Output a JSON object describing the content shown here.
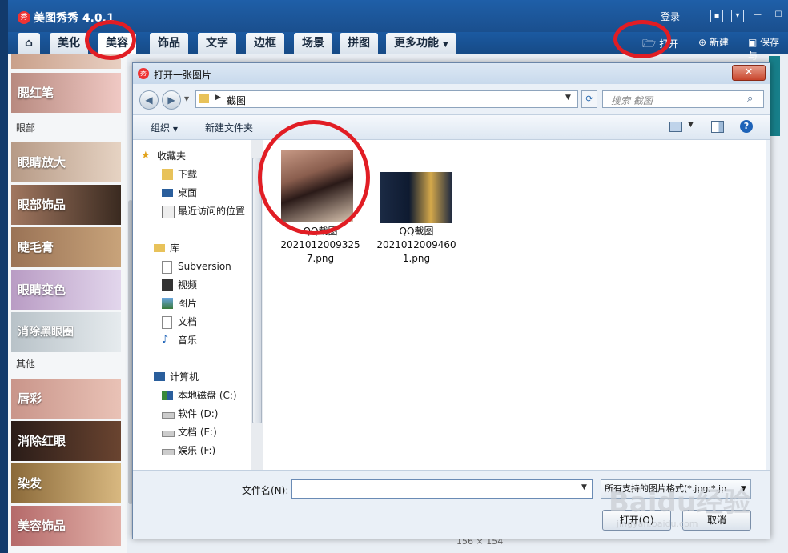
{
  "app": {
    "logo_text": "秀",
    "title": "美图秀秀 4.0.1",
    "login": "登录",
    "tabs": [
      "美化",
      "美容",
      "饰品",
      "文字",
      "边框",
      "场景",
      "拼图",
      "更多功能"
    ],
    "active_tab": "美容",
    "toolbar": {
      "open": "打开",
      "new": "新建",
      "save": "保存与"
    }
  },
  "left_panel": {
    "sections": {
      "eye": "眼部",
      "other": "其他"
    },
    "items": [
      "腮红笔",
      "眼睛放大",
      "眼部饰品",
      "睫毛膏",
      "眼睛变色",
      "消除黑眼圈",
      "唇彩",
      "消除红眼",
      "染发",
      "美容饰品"
    ]
  },
  "dialog": {
    "title": "打开一张图片",
    "path": "截图",
    "search_placeholder": "搜索 截图",
    "commands": {
      "organize": "组织",
      "new_folder": "新建文件夹"
    },
    "nav": {
      "favorites": "收藏夹",
      "favorites_items": [
        "下载",
        "桌面",
        "最近访问的位置"
      ],
      "libraries": "库",
      "libraries_items": [
        "Subversion",
        "视频",
        "图片",
        "文档",
        "音乐"
      ],
      "computer": "计算机",
      "drives": [
        "本地磁盘 (C:)",
        "软件 (D:)",
        "文档 (E:)",
        "娱乐 (F:)"
      ]
    },
    "files": [
      {
        "name_lines": [
          "QQ截图",
          "2021012009325",
          "7.png"
        ]
      },
      {
        "name_lines": [
          "QQ截图",
          "2021012009460",
          "1.png"
        ]
      }
    ],
    "filename_label": "文件名(N):",
    "filename_value": "",
    "filetype": "所有支持的图片格式(*.jpg;*.jp",
    "open_button": "打开(O)",
    "cancel_button": "取消"
  },
  "status": {
    "text": "156 × 154"
  },
  "watermark": {
    "main": "Baidu经验",
    "sub": "jingyan.baidu.com"
  },
  "colors": {
    "accent": "#1a4f8e",
    "annotation": "#e11d24"
  }
}
